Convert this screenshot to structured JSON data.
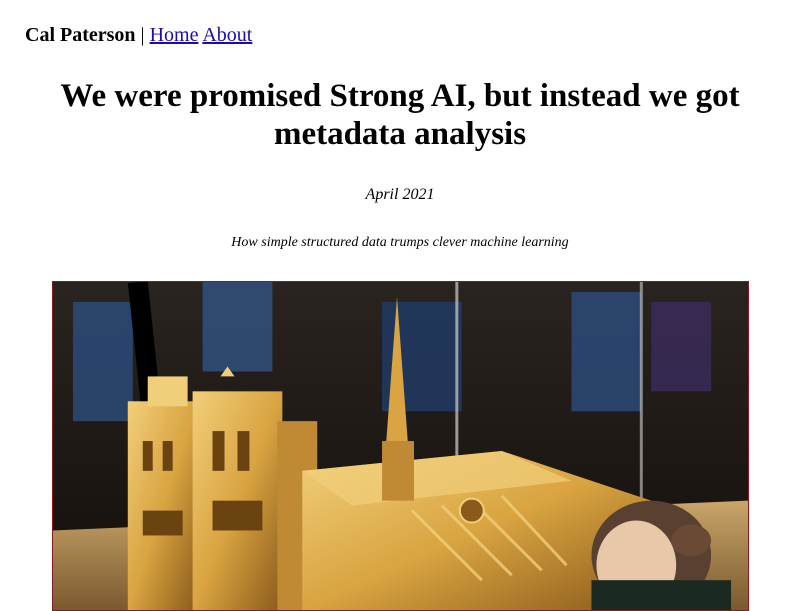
{
  "nav": {
    "site_name": "Cal Paterson",
    "separator": "|",
    "links": [
      {
        "label": "Home"
      },
      {
        "label": "About"
      }
    ]
  },
  "article": {
    "title": "We were promised Strong AI, but instead we got metadata analysis",
    "date": "April 2021",
    "subtitle": "How simple structured data trumps clever machine learning"
  },
  "hero_image": {
    "alt": "Model of Notre-Dame cathedral in a glass display case with a visitor looking at it",
    "colors": {
      "background": "#1a1410",
      "gold": "#d9a441",
      "gold_light": "#f1cf7a",
      "gold_dark": "#8a5a1a",
      "glass_blue": "#2b4a7a",
      "border": "#8a1b1b"
    }
  }
}
